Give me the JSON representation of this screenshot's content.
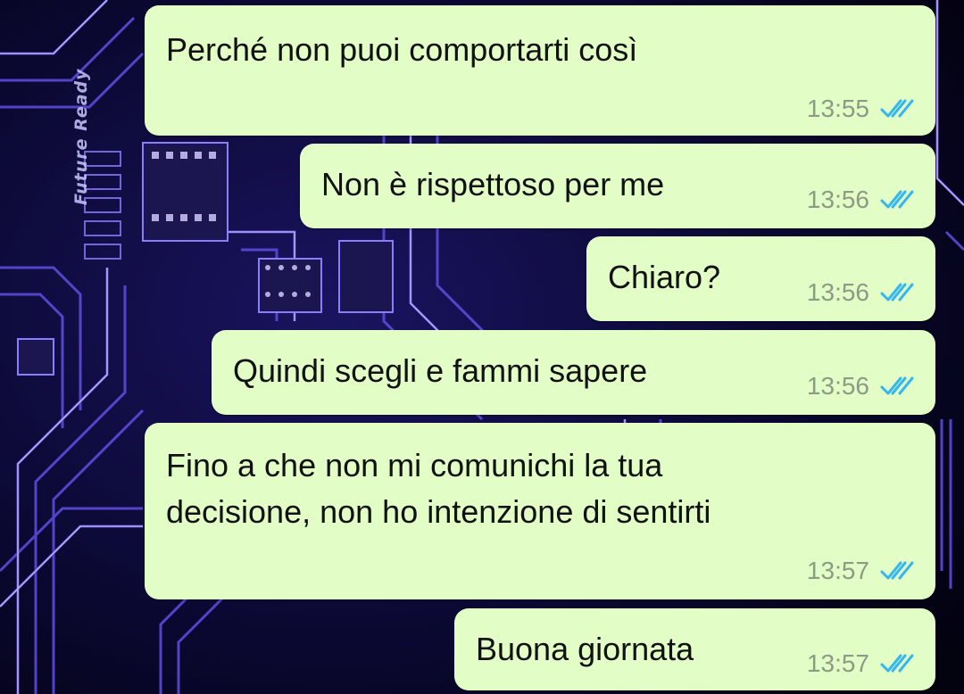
{
  "wallpaper": {
    "caption": "Future Ready",
    "colors": {
      "base": "#050418",
      "trace": "#5b4ad9",
      "glow": "#d8d3ff"
    }
  },
  "conversation": {
    "bubble_color": "#e2fdc6",
    "read_check_color": "#34b7f1",
    "messages": [
      {
        "lines": [
          "Perché non puoi comportarti così"
        ],
        "time": "13:55",
        "status": "read"
      },
      {
        "lines": [
          "Non è rispettoso per me"
        ],
        "time": "13:56",
        "status": "read"
      },
      {
        "lines": [
          "Chiaro?"
        ],
        "time": "13:56",
        "status": "read"
      },
      {
        "lines": [
          "Quindi scegli e fammi sapere"
        ],
        "time": "13:56",
        "status": "read"
      },
      {
        "lines": [
          "Fino a che non mi comunichi la tua",
          "decisione, non ho intenzione di sentirti"
        ],
        "time": "13:57",
        "status": "read"
      },
      {
        "lines": [
          "Buona giornata"
        ],
        "time": "13:57",
        "status": "read"
      }
    ]
  }
}
